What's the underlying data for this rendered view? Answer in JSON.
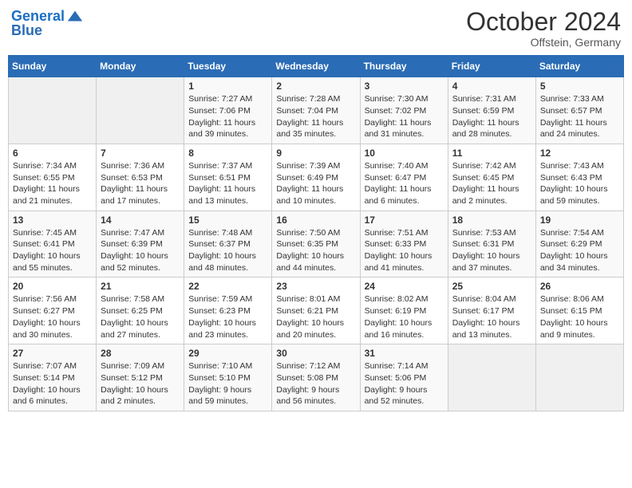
{
  "header": {
    "logo_line1": "General",
    "logo_line2": "Blue",
    "month": "October 2024",
    "location": "Offstein, Germany"
  },
  "days_of_week": [
    "Sunday",
    "Monday",
    "Tuesday",
    "Wednesday",
    "Thursday",
    "Friday",
    "Saturday"
  ],
  "weeks": [
    [
      {
        "day": "",
        "sunrise": "",
        "sunset": "",
        "daylight": ""
      },
      {
        "day": "",
        "sunrise": "",
        "sunset": "",
        "daylight": ""
      },
      {
        "day": "1",
        "sunrise": "Sunrise: 7:27 AM",
        "sunset": "Sunset: 7:06 PM",
        "daylight": "Daylight: 11 hours and 39 minutes."
      },
      {
        "day": "2",
        "sunrise": "Sunrise: 7:28 AM",
        "sunset": "Sunset: 7:04 PM",
        "daylight": "Daylight: 11 hours and 35 minutes."
      },
      {
        "day": "3",
        "sunrise": "Sunrise: 7:30 AM",
        "sunset": "Sunset: 7:02 PM",
        "daylight": "Daylight: 11 hours and 31 minutes."
      },
      {
        "day": "4",
        "sunrise": "Sunrise: 7:31 AM",
        "sunset": "Sunset: 6:59 PM",
        "daylight": "Daylight: 11 hours and 28 minutes."
      },
      {
        "day": "5",
        "sunrise": "Sunrise: 7:33 AM",
        "sunset": "Sunset: 6:57 PM",
        "daylight": "Daylight: 11 hours and 24 minutes."
      }
    ],
    [
      {
        "day": "6",
        "sunrise": "Sunrise: 7:34 AM",
        "sunset": "Sunset: 6:55 PM",
        "daylight": "Daylight: 11 hours and 21 minutes."
      },
      {
        "day": "7",
        "sunrise": "Sunrise: 7:36 AM",
        "sunset": "Sunset: 6:53 PM",
        "daylight": "Daylight: 11 hours and 17 minutes."
      },
      {
        "day": "8",
        "sunrise": "Sunrise: 7:37 AM",
        "sunset": "Sunset: 6:51 PM",
        "daylight": "Daylight: 11 hours and 13 minutes."
      },
      {
        "day": "9",
        "sunrise": "Sunrise: 7:39 AM",
        "sunset": "Sunset: 6:49 PM",
        "daylight": "Daylight: 11 hours and 10 minutes."
      },
      {
        "day": "10",
        "sunrise": "Sunrise: 7:40 AM",
        "sunset": "Sunset: 6:47 PM",
        "daylight": "Daylight: 11 hours and 6 minutes."
      },
      {
        "day": "11",
        "sunrise": "Sunrise: 7:42 AM",
        "sunset": "Sunset: 6:45 PM",
        "daylight": "Daylight: 11 hours and 2 minutes."
      },
      {
        "day": "12",
        "sunrise": "Sunrise: 7:43 AM",
        "sunset": "Sunset: 6:43 PM",
        "daylight": "Daylight: 10 hours and 59 minutes."
      }
    ],
    [
      {
        "day": "13",
        "sunrise": "Sunrise: 7:45 AM",
        "sunset": "Sunset: 6:41 PM",
        "daylight": "Daylight: 10 hours and 55 minutes."
      },
      {
        "day": "14",
        "sunrise": "Sunrise: 7:47 AM",
        "sunset": "Sunset: 6:39 PM",
        "daylight": "Daylight: 10 hours and 52 minutes."
      },
      {
        "day": "15",
        "sunrise": "Sunrise: 7:48 AM",
        "sunset": "Sunset: 6:37 PM",
        "daylight": "Daylight: 10 hours and 48 minutes."
      },
      {
        "day": "16",
        "sunrise": "Sunrise: 7:50 AM",
        "sunset": "Sunset: 6:35 PM",
        "daylight": "Daylight: 10 hours and 44 minutes."
      },
      {
        "day": "17",
        "sunrise": "Sunrise: 7:51 AM",
        "sunset": "Sunset: 6:33 PM",
        "daylight": "Daylight: 10 hours and 41 minutes."
      },
      {
        "day": "18",
        "sunrise": "Sunrise: 7:53 AM",
        "sunset": "Sunset: 6:31 PM",
        "daylight": "Daylight: 10 hours and 37 minutes."
      },
      {
        "day": "19",
        "sunrise": "Sunrise: 7:54 AM",
        "sunset": "Sunset: 6:29 PM",
        "daylight": "Daylight: 10 hours and 34 minutes."
      }
    ],
    [
      {
        "day": "20",
        "sunrise": "Sunrise: 7:56 AM",
        "sunset": "Sunset: 6:27 PM",
        "daylight": "Daylight: 10 hours and 30 minutes."
      },
      {
        "day": "21",
        "sunrise": "Sunrise: 7:58 AM",
        "sunset": "Sunset: 6:25 PM",
        "daylight": "Daylight: 10 hours and 27 minutes."
      },
      {
        "day": "22",
        "sunrise": "Sunrise: 7:59 AM",
        "sunset": "Sunset: 6:23 PM",
        "daylight": "Daylight: 10 hours and 23 minutes."
      },
      {
        "day": "23",
        "sunrise": "Sunrise: 8:01 AM",
        "sunset": "Sunset: 6:21 PM",
        "daylight": "Daylight: 10 hours and 20 minutes."
      },
      {
        "day": "24",
        "sunrise": "Sunrise: 8:02 AM",
        "sunset": "Sunset: 6:19 PM",
        "daylight": "Daylight: 10 hours and 16 minutes."
      },
      {
        "day": "25",
        "sunrise": "Sunrise: 8:04 AM",
        "sunset": "Sunset: 6:17 PM",
        "daylight": "Daylight: 10 hours and 13 minutes."
      },
      {
        "day": "26",
        "sunrise": "Sunrise: 8:06 AM",
        "sunset": "Sunset: 6:15 PM",
        "daylight": "Daylight: 10 hours and 9 minutes."
      }
    ],
    [
      {
        "day": "27",
        "sunrise": "Sunrise: 7:07 AM",
        "sunset": "Sunset: 5:14 PM",
        "daylight": "Daylight: 10 hours and 6 minutes."
      },
      {
        "day": "28",
        "sunrise": "Sunrise: 7:09 AM",
        "sunset": "Sunset: 5:12 PM",
        "daylight": "Daylight: 10 hours and 2 minutes."
      },
      {
        "day": "29",
        "sunrise": "Sunrise: 7:10 AM",
        "sunset": "Sunset: 5:10 PM",
        "daylight": "Daylight: 9 hours and 59 minutes."
      },
      {
        "day": "30",
        "sunrise": "Sunrise: 7:12 AM",
        "sunset": "Sunset: 5:08 PM",
        "daylight": "Daylight: 9 hours and 56 minutes."
      },
      {
        "day": "31",
        "sunrise": "Sunrise: 7:14 AM",
        "sunset": "Sunset: 5:06 PM",
        "daylight": "Daylight: 9 hours and 52 minutes."
      },
      {
        "day": "",
        "sunrise": "",
        "sunset": "",
        "daylight": ""
      },
      {
        "day": "",
        "sunrise": "",
        "sunset": "",
        "daylight": ""
      }
    ]
  ]
}
